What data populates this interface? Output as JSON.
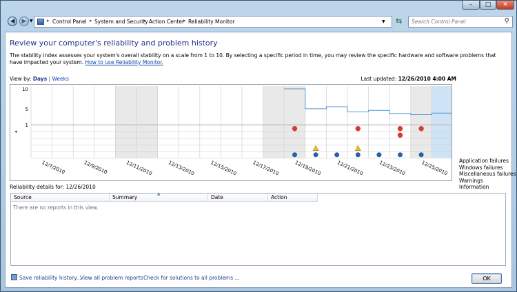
{
  "address": {
    "crumbs": [
      "Control Panel",
      "System and Security",
      "Action Center",
      "Reliability Monitor"
    ],
    "search_placeholder": "Search Control Panel"
  },
  "page": {
    "title": "Review your computer's reliability and problem history",
    "description": "The stability index assesses your system's overall stability on a scale from 1 to 10. By selecting a specific period in time, you may review the specific hardware and software problems that have impacted your system.",
    "description_link": "How to use Reliability Monitor.",
    "view_by_label": "View by:",
    "view_days": "Days",
    "view_sep": "|",
    "view_weeks": "Weeks",
    "last_updated_label": "Last updated:",
    "last_updated_value": "12/26/2010 4:00 AM",
    "details_label": "Reliability details for: 12/26/2010"
  },
  "chart_data": {
    "type": "line",
    "title": "",
    "y_ticks": [
      "10",
      "5",
      "1"
    ],
    "ylim": [
      1,
      10
    ],
    "dates": [
      "12/7/2010",
      "12/8/2010",
      "12/9/2010",
      "12/10/2010",
      "12/11/2010",
      "12/12/2010",
      "12/13/2010",
      "12/14/2010",
      "12/15/2010",
      "12/16/2010",
      "12/17/2010",
      "12/18/2010",
      "12/19/2010",
      "12/20/2010",
      "12/21/2010",
      "12/22/2010",
      "12/23/2010",
      "12/24/2010",
      "12/25/2010",
      "12/26/2010"
    ],
    "x_tick_labels": [
      "12/7/2010",
      "12/9/2010",
      "12/11/2010",
      "12/13/2010",
      "12/15/2010",
      "12/17/2010",
      "12/19/2010",
      "12/21/2010",
      "12/23/2010",
      "12/25/2010"
    ],
    "stability_index": [
      null,
      null,
      null,
      null,
      null,
      null,
      null,
      null,
      null,
      null,
      null,
      null,
      10,
      5.0,
      5.5,
      4.2,
      4.6,
      3.8,
      3.5,
      3.9
    ],
    "selected_date": "12/26/2010",
    "rows": [
      "Application failures",
      "Windows failures",
      "Miscellaneous failures",
      "Warnings",
      "Information"
    ],
    "events": {
      "application_failures": [
        "12/19/2010",
        "12/22/2010",
        "12/24/2010",
        "12/25/2010"
      ],
      "windows_failures": [
        "12/24/2010"
      ],
      "miscellaneous_failures": [],
      "warnings": [
        "12/20/2010",
        "12/22/2010"
      ],
      "information": [
        "12/19/2010",
        "12/20/2010",
        "12/21/2010",
        "12/22/2010",
        "12/23/2010",
        "12/24/2010",
        "12/25/2010"
      ]
    },
    "colors": {
      "line": "#4f98d8",
      "weekend_fill": "#e9e9e9",
      "selected_fill": "#cfe3f7",
      "error": "#d63c2f",
      "warning": "#f0c419",
      "info": "#2a5fae"
    }
  },
  "table": {
    "columns": [
      "Source",
      "Summary",
      "Date",
      "Action"
    ],
    "empty_text": "There are no reports in this view."
  },
  "footer": {
    "save_history": "Save reliability history...",
    "view_all": "View all problem reports",
    "check_solutions": "Check for solutions to all problems ...",
    "ok": "OK"
  }
}
